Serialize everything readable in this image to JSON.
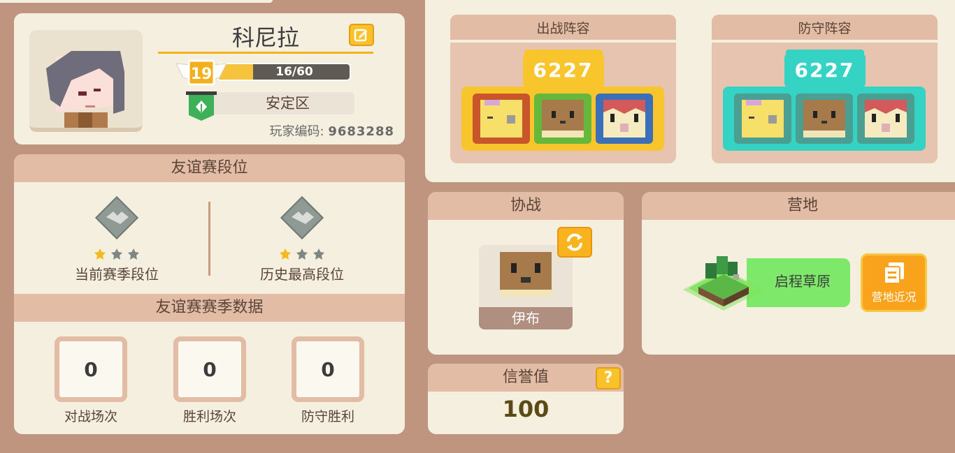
{
  "profile": {
    "name": "科尼拉",
    "level": "19",
    "xp_text": "16/60",
    "xp_fraction": 0.267,
    "server": "安定区",
    "id_label": "玩家编码:",
    "id_value": "9683288"
  },
  "rank": {
    "title": "友谊赛段位",
    "current_label": "当前赛季段位",
    "history_label": "历史最高段位",
    "current_stars": 1,
    "history_stars": 1,
    "season_title": "友谊赛赛季数据",
    "stats": [
      {
        "value": "0",
        "label": "对战场次"
      },
      {
        "value": "0",
        "label": "胜利场次"
      },
      {
        "value": "0",
        "label": "防守胜利"
      }
    ]
  },
  "lineups": {
    "attack": {
      "title": "出战阵容",
      "power": "6227",
      "color": "#f8c52c"
    },
    "defense": {
      "title": "防守阵容",
      "power": "6227",
      "color": "#34d3c4"
    }
  },
  "assist": {
    "title": "协战",
    "pokemon_name": "伊布"
  },
  "camp": {
    "title": "营地",
    "name": "启程草原",
    "button_label": "营地近况"
  },
  "credit": {
    "title": "信誉值",
    "value": "100",
    "help_label": "?"
  }
}
